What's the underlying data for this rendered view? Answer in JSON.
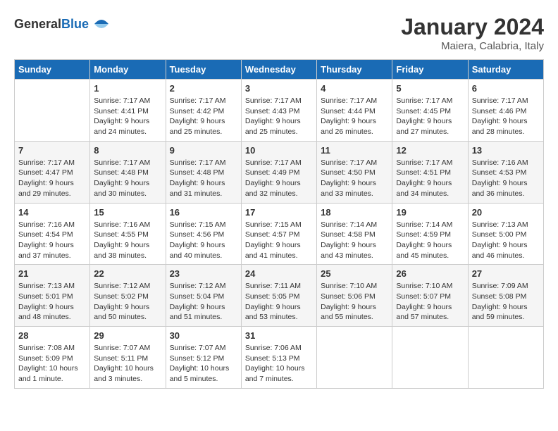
{
  "header": {
    "logo_general": "General",
    "logo_blue": "Blue",
    "month_year": "January 2024",
    "location": "Maiera, Calabria, Italy"
  },
  "columns": [
    "Sunday",
    "Monday",
    "Tuesday",
    "Wednesday",
    "Thursday",
    "Friday",
    "Saturday"
  ],
  "weeks": [
    [
      {
        "day": "",
        "sunrise": "",
        "sunset": "",
        "daylight": ""
      },
      {
        "day": "1",
        "sunrise": "Sunrise: 7:17 AM",
        "sunset": "Sunset: 4:41 PM",
        "daylight": "Daylight: 9 hours and 24 minutes."
      },
      {
        "day": "2",
        "sunrise": "Sunrise: 7:17 AM",
        "sunset": "Sunset: 4:42 PM",
        "daylight": "Daylight: 9 hours and 25 minutes."
      },
      {
        "day": "3",
        "sunrise": "Sunrise: 7:17 AM",
        "sunset": "Sunset: 4:43 PM",
        "daylight": "Daylight: 9 hours and 25 minutes."
      },
      {
        "day": "4",
        "sunrise": "Sunrise: 7:17 AM",
        "sunset": "Sunset: 4:44 PM",
        "daylight": "Daylight: 9 hours and 26 minutes."
      },
      {
        "day": "5",
        "sunrise": "Sunrise: 7:17 AM",
        "sunset": "Sunset: 4:45 PM",
        "daylight": "Daylight: 9 hours and 27 minutes."
      },
      {
        "day": "6",
        "sunrise": "Sunrise: 7:17 AM",
        "sunset": "Sunset: 4:46 PM",
        "daylight": "Daylight: 9 hours and 28 minutes."
      }
    ],
    [
      {
        "day": "7",
        "sunrise": "Sunrise: 7:17 AM",
        "sunset": "Sunset: 4:47 PM",
        "daylight": "Daylight: 9 hours and 29 minutes."
      },
      {
        "day": "8",
        "sunrise": "Sunrise: 7:17 AM",
        "sunset": "Sunset: 4:48 PM",
        "daylight": "Daylight: 9 hours and 30 minutes."
      },
      {
        "day": "9",
        "sunrise": "Sunrise: 7:17 AM",
        "sunset": "Sunset: 4:48 PM",
        "daylight": "Daylight: 9 hours and 31 minutes."
      },
      {
        "day": "10",
        "sunrise": "Sunrise: 7:17 AM",
        "sunset": "Sunset: 4:49 PM",
        "daylight": "Daylight: 9 hours and 32 minutes."
      },
      {
        "day": "11",
        "sunrise": "Sunrise: 7:17 AM",
        "sunset": "Sunset: 4:50 PM",
        "daylight": "Daylight: 9 hours and 33 minutes."
      },
      {
        "day": "12",
        "sunrise": "Sunrise: 7:17 AM",
        "sunset": "Sunset: 4:51 PM",
        "daylight": "Daylight: 9 hours and 34 minutes."
      },
      {
        "day": "13",
        "sunrise": "Sunrise: 7:16 AM",
        "sunset": "Sunset: 4:53 PM",
        "daylight": "Daylight: 9 hours and 36 minutes."
      }
    ],
    [
      {
        "day": "14",
        "sunrise": "Sunrise: 7:16 AM",
        "sunset": "Sunset: 4:54 PM",
        "daylight": "Daylight: 9 hours and 37 minutes."
      },
      {
        "day": "15",
        "sunrise": "Sunrise: 7:16 AM",
        "sunset": "Sunset: 4:55 PM",
        "daylight": "Daylight: 9 hours and 38 minutes."
      },
      {
        "day": "16",
        "sunrise": "Sunrise: 7:15 AM",
        "sunset": "Sunset: 4:56 PM",
        "daylight": "Daylight: 9 hours and 40 minutes."
      },
      {
        "day": "17",
        "sunrise": "Sunrise: 7:15 AM",
        "sunset": "Sunset: 4:57 PM",
        "daylight": "Daylight: 9 hours and 41 minutes."
      },
      {
        "day": "18",
        "sunrise": "Sunrise: 7:14 AM",
        "sunset": "Sunset: 4:58 PM",
        "daylight": "Daylight: 9 hours and 43 minutes."
      },
      {
        "day": "19",
        "sunrise": "Sunrise: 7:14 AM",
        "sunset": "Sunset: 4:59 PM",
        "daylight": "Daylight: 9 hours and 45 minutes."
      },
      {
        "day": "20",
        "sunrise": "Sunrise: 7:13 AM",
        "sunset": "Sunset: 5:00 PM",
        "daylight": "Daylight: 9 hours and 46 minutes."
      }
    ],
    [
      {
        "day": "21",
        "sunrise": "Sunrise: 7:13 AM",
        "sunset": "Sunset: 5:01 PM",
        "daylight": "Daylight: 9 hours and 48 minutes."
      },
      {
        "day": "22",
        "sunrise": "Sunrise: 7:12 AM",
        "sunset": "Sunset: 5:02 PM",
        "daylight": "Daylight: 9 hours and 50 minutes."
      },
      {
        "day": "23",
        "sunrise": "Sunrise: 7:12 AM",
        "sunset": "Sunset: 5:04 PM",
        "daylight": "Daylight: 9 hours and 51 minutes."
      },
      {
        "day": "24",
        "sunrise": "Sunrise: 7:11 AM",
        "sunset": "Sunset: 5:05 PM",
        "daylight": "Daylight: 9 hours and 53 minutes."
      },
      {
        "day": "25",
        "sunrise": "Sunrise: 7:10 AM",
        "sunset": "Sunset: 5:06 PM",
        "daylight": "Daylight: 9 hours and 55 minutes."
      },
      {
        "day": "26",
        "sunrise": "Sunrise: 7:10 AM",
        "sunset": "Sunset: 5:07 PM",
        "daylight": "Daylight: 9 hours and 57 minutes."
      },
      {
        "day": "27",
        "sunrise": "Sunrise: 7:09 AM",
        "sunset": "Sunset: 5:08 PM",
        "daylight": "Daylight: 9 hours and 59 minutes."
      }
    ],
    [
      {
        "day": "28",
        "sunrise": "Sunrise: 7:08 AM",
        "sunset": "Sunset: 5:09 PM",
        "daylight": "Daylight: 10 hours and 1 minute."
      },
      {
        "day": "29",
        "sunrise": "Sunrise: 7:07 AM",
        "sunset": "Sunset: 5:11 PM",
        "daylight": "Daylight: 10 hours and 3 minutes."
      },
      {
        "day": "30",
        "sunrise": "Sunrise: 7:07 AM",
        "sunset": "Sunset: 5:12 PM",
        "daylight": "Daylight: 10 hours and 5 minutes."
      },
      {
        "day": "31",
        "sunrise": "Sunrise: 7:06 AM",
        "sunset": "Sunset: 5:13 PM",
        "daylight": "Daylight: 10 hours and 7 minutes."
      },
      {
        "day": "",
        "sunrise": "",
        "sunset": "",
        "daylight": ""
      },
      {
        "day": "",
        "sunrise": "",
        "sunset": "",
        "daylight": ""
      },
      {
        "day": "",
        "sunrise": "",
        "sunset": "",
        "daylight": ""
      }
    ]
  ]
}
